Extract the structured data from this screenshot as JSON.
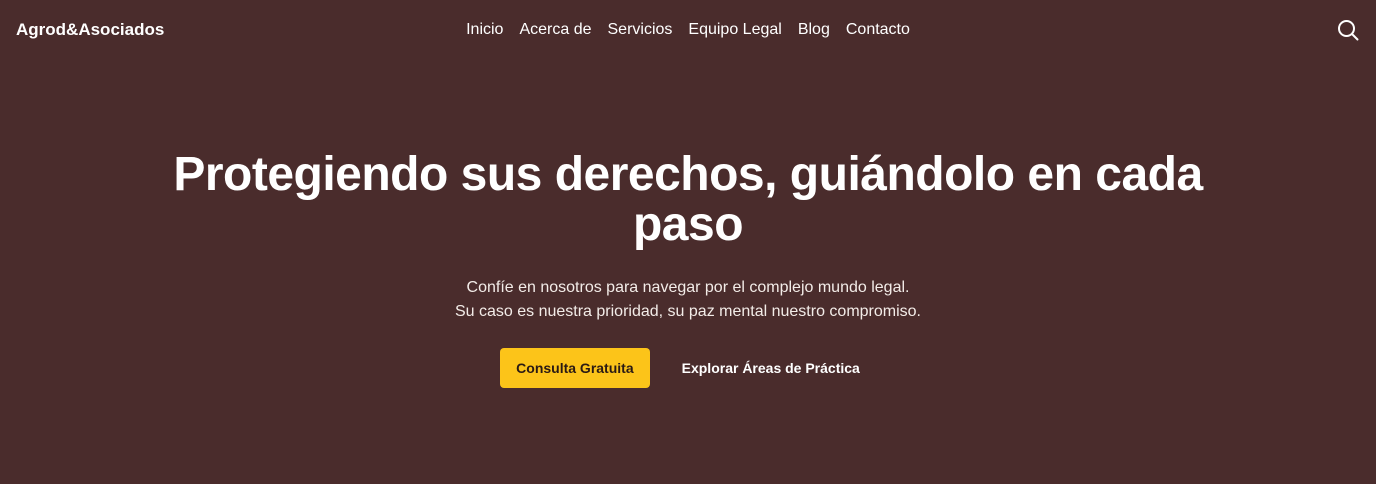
{
  "header": {
    "brand": "Agrod&Asociados",
    "nav": [
      {
        "label": "Inicio"
      },
      {
        "label": "Acerca de"
      },
      {
        "label": "Servicios"
      },
      {
        "label": "Equipo Legal"
      },
      {
        "label": "Blog"
      },
      {
        "label": "Contacto"
      }
    ],
    "search_icon": "search-icon"
  },
  "hero": {
    "title": "Protegiendo sus derechos, guiándolo en cada paso",
    "subtitle_line1": "Confíe en nosotros para navegar por el complejo mundo legal.",
    "subtitle_line2": "Su caso es nuestra prioridad, su paz mental nuestro compromiso.",
    "primary_cta": "Consulta Gratuita",
    "secondary_cta": "Explorar Áreas de Práctica"
  },
  "colors": {
    "background": "#4a2c2c",
    "accent": "#fcc419",
    "text": "#ffffff"
  }
}
